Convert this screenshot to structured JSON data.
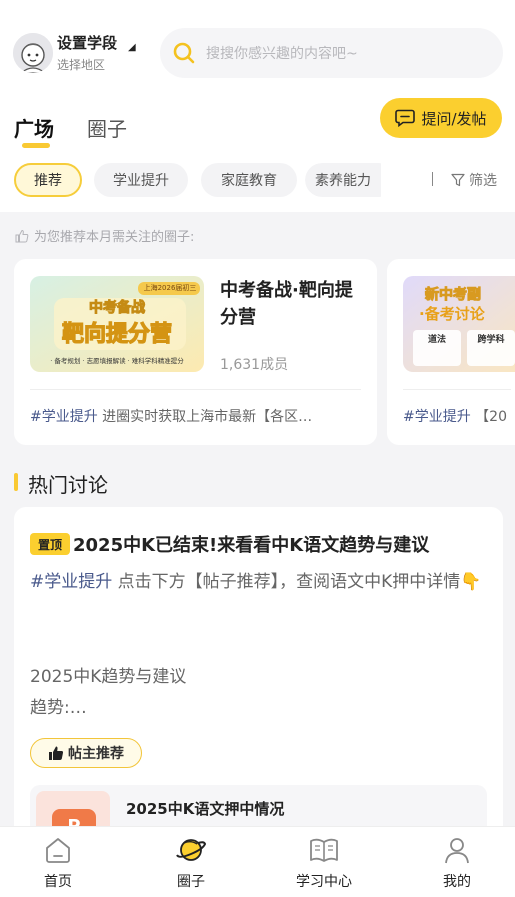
{
  "header": {
    "stage_title": "设置学段",
    "stage_subtitle": "选择地区",
    "search_placeholder": "搜搜你感兴趣的内容吧~"
  },
  "tabs": [
    {
      "label": "广场",
      "active": true
    },
    {
      "label": "圈子",
      "active": false
    }
  ],
  "ask_button": "提问/发帖",
  "chips": [
    {
      "label": "推荐",
      "active": true
    },
    {
      "label": "学业提升",
      "active": false
    },
    {
      "label": "家庭教育",
      "active": false
    },
    {
      "label": "素养能力",
      "active": false
    }
  ],
  "filter_label": "筛选",
  "recommend_note": "为您推荐本月需关注的圈子:",
  "circles": [
    {
      "title": "中考备战·靶向提分营",
      "members": "1,631成员",
      "tag": "#学业提升",
      "desc": " 进圈实时获取上海市最新【各区…",
      "thumb": {
        "tag": "上海2026届初三",
        "line1": "中考备战",
        "line2": "靶向提分营",
        "footer": "· 备考规划  · 志愿填报解读  · 难科学科精准提分"
      }
    },
    {
      "tag": "#学业提升",
      "desc": " 【20",
      "thumb": {
        "line1": "新中考副",
        "line2": "·备考讨论",
        "box1": "道法",
        "box2": "跨学科"
      }
    }
  ],
  "hot": {
    "title": "热门讨论",
    "post": {
      "pin_label": "置顶",
      "title": "2025中K已结束!来看看中K语文趋势与建议",
      "tag": "#学业提升",
      "body": " 点击下方【帖子推荐】，查阅语文中K押中详情👇",
      "line1": "2025中K趋势与建议",
      "line2": "趋势:…",
      "author_badge": "帖主推荐",
      "rec_title": "2025中K语文押中情况",
      "rec_thumb_letter": "P"
    }
  },
  "bottom_nav": [
    {
      "label": "首页",
      "icon": "home-icon"
    },
    {
      "label": "圈子",
      "icon": "planet-icon",
      "active": true
    },
    {
      "label": "学习中心",
      "icon": "book-icon"
    },
    {
      "label": "我的",
      "icon": "user-icon"
    }
  ],
  "colors": {
    "accent": "#fbcf2f",
    "tag": "#4a5a8c",
    "background": "#f4f4f6"
  }
}
